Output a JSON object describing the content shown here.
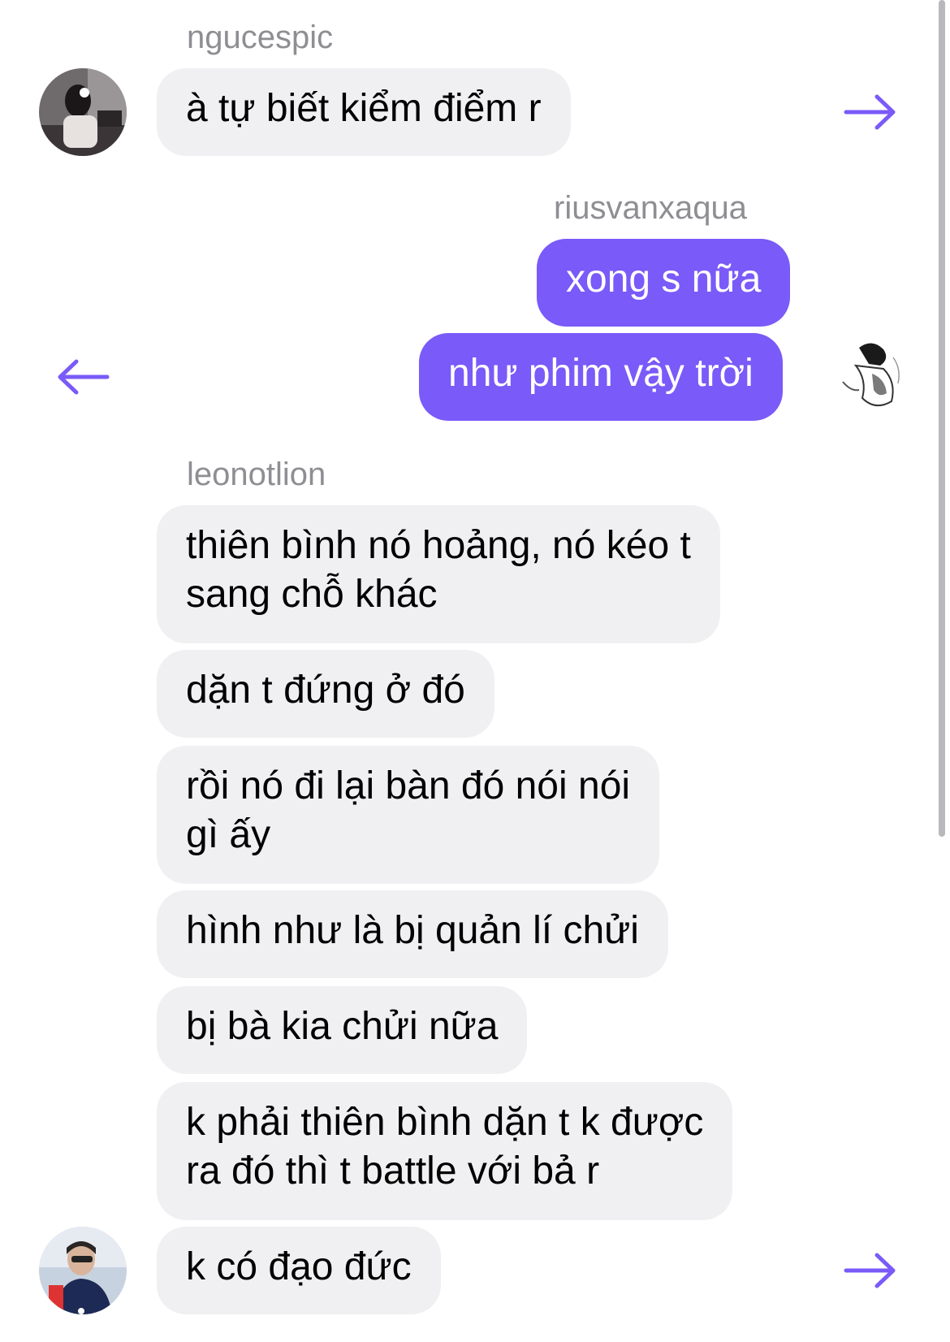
{
  "colors": {
    "accent": "#7a5af8",
    "incoming_bubble": "#f0f0f2",
    "sender_name": "#8e8e93"
  },
  "messages": {
    "group1": {
      "sender": "ngucespic",
      "texts": [
        "à tự biết kiểm điểm r"
      ],
      "avatar": "avatar-ngucespic",
      "action_icon": "forward-arrow-icon"
    },
    "group2": {
      "sender": "riusvanxaqua",
      "texts": [
        "xong s nữa",
        "như phim vậy trời"
      ],
      "avatar": "avatar-riusvanxaqua",
      "action_icon": "back-arrow-icon"
    },
    "group3": {
      "sender": "leonotlion",
      "texts": [
        "thiên bình nó hoảng, nó kéo t\nsang chỗ khác",
        "dặn t đứng ở đó",
        "rồi nó đi lại bàn đó nói nói\ngì ấy",
        "hình như là bị quản lí chửi",
        "bị bà kia chửi nữa",
        "k phải thiên bình dặn t k được\nra đó thì t battle với bả r",
        "k có đạo đức"
      ],
      "avatar": "avatar-leonotlion",
      "action_icon": "forward-arrow-icon"
    }
  }
}
